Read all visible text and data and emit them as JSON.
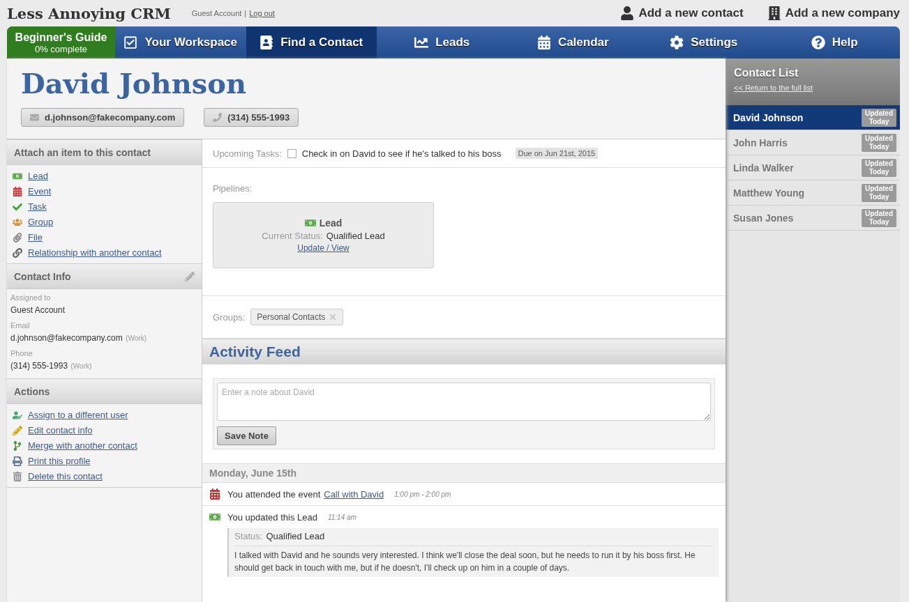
{
  "header": {
    "logo": "Less Annoying CRM",
    "account": "Guest Account",
    "separator": "|",
    "logout": "Log out",
    "actions": [
      "Add a new contact",
      "Add a new company"
    ]
  },
  "nav": [
    {
      "kind": "guide",
      "title": "Beginner's Guide",
      "subtitle": "0% complete"
    },
    {
      "kind": "tab",
      "label": "Your Workspace",
      "selected": false
    },
    {
      "kind": "tab",
      "label": "Find a Contact",
      "selected": true
    },
    {
      "kind": "tab",
      "label": "Leads",
      "selected": false
    },
    {
      "kind": "tab",
      "label": "Calendar",
      "selected": false
    },
    {
      "kind": "tab",
      "label": "Settings",
      "selected": false
    },
    {
      "kind": "tab",
      "label": "Help",
      "selected": false
    }
  ],
  "contact": {
    "name": "David Johnson",
    "email": "d.johnson@fakecompany.com",
    "phone": "(314) 555-1993"
  },
  "attach": {
    "title": "Attach an item to this contact",
    "items": [
      "Lead",
      "Event",
      "Task",
      "Group",
      "File",
      "Relationship with another contact"
    ]
  },
  "contact_info": {
    "title": "Contact Info",
    "fields": [
      {
        "label": "Assigned to",
        "value": "Guest Account"
      },
      {
        "label": "Email",
        "value": "d.johnson@fakecompany.com",
        "note": "(Work)"
      },
      {
        "label": "Phone",
        "value": "(314) 555-1993",
        "note": "(Work)"
      }
    ]
  },
  "actions": {
    "title": "Actions",
    "items": [
      "Assign to a different user",
      "Edit contact info",
      "Merge with another contact",
      "Print this profile",
      "Delete this contact"
    ]
  },
  "tasks": {
    "label": "Upcoming Tasks:",
    "items": [
      {
        "text": "Check in on David to see if he's talked to his boss",
        "checked": false,
        "due": "Due on Jun 21st, 2015"
      }
    ]
  },
  "pipelines": {
    "label": "Pipelines:",
    "cards": [
      {
        "title": "Lead",
        "status_label": "Current Status:",
        "status": "Qualified Lead",
        "link": "Update / View"
      }
    ]
  },
  "groups": {
    "label": "Groups:",
    "tags": [
      "Personal Contacts"
    ]
  },
  "activity": {
    "title": "Activity Feed",
    "placeholder": "Enter a note about David",
    "button": "Save Note",
    "day": "Monday, June 15th",
    "entries": [
      {
        "kind": "event",
        "text": "You attended the event",
        "link": "Call with David",
        "time": "1:00 pm - 2:00 pm"
      },
      {
        "kind": "update",
        "text": "You updated this Lead",
        "time": "11:14 am",
        "status_label": "Status:",
        "status": "Qualified Lead",
        "note": "I talked with David and he sounds very interested. I think we'll close the deal soon, but he needs to run it by his boss first. He should get back in touch with me, but if he doesn't, I'll check up on him in a couple of days."
      }
    ]
  },
  "contact_list": {
    "title": "Contact List",
    "link": "<< Return to the full list",
    "items": [
      {
        "name": "David Johnson",
        "badge": "Updated Today",
        "selected": true
      },
      {
        "name": "John Harris",
        "badge": "Updated Today",
        "selected": false
      },
      {
        "name": "Linda Walker",
        "badge": "Updated Today",
        "selected": false
      },
      {
        "name": "Matthew Young",
        "badge": "Updated Today",
        "selected": false
      },
      {
        "name": "Susan Jones",
        "badge": "Updated Today",
        "selected": false
      }
    ]
  }
}
